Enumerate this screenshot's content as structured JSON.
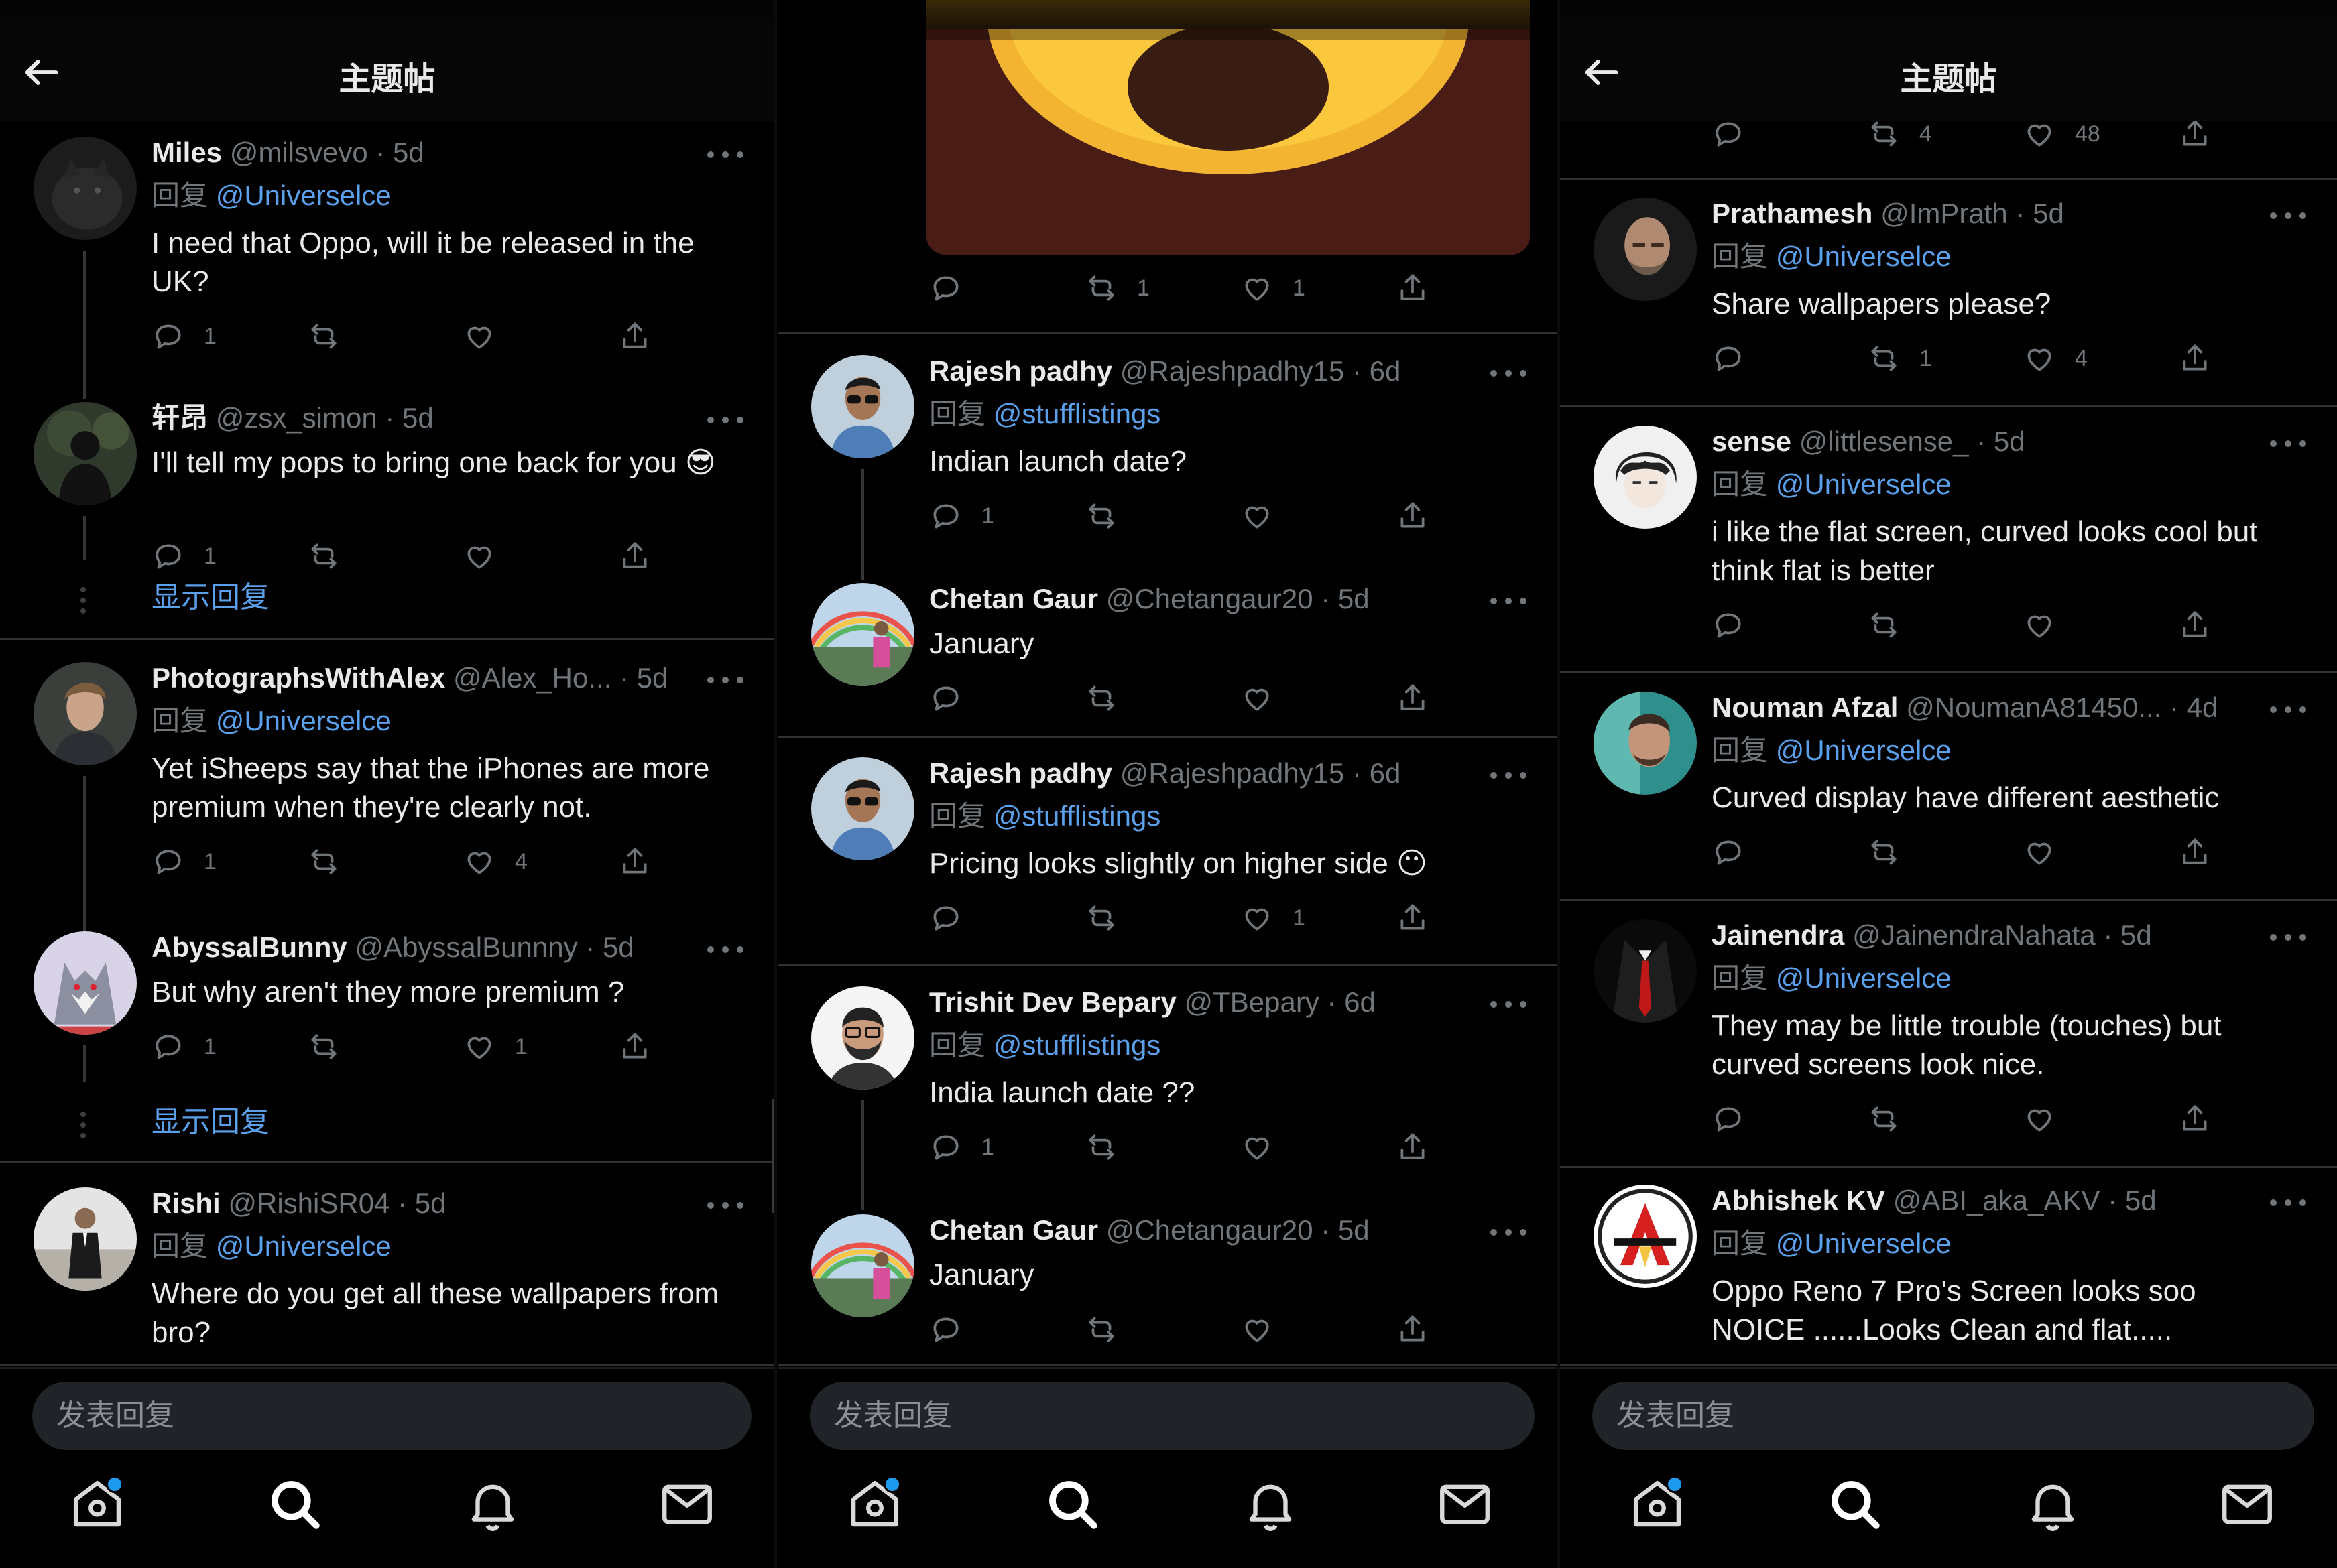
{
  "header": {
    "title": "主题帖"
  },
  "composer": {
    "placeholder": "发表回复"
  },
  "reply_prefix": "回复",
  "show_replies_label": "显示回复",
  "colors": {
    "mention": "#5aa0ea",
    "badge": "#1d9bf0",
    "background": "#000000"
  },
  "nav": [
    "home-icon",
    "search-icon",
    "bell-icon",
    "mail-icon"
  ],
  "panels": [
    {
      "tweets": [
        {
          "name": "Miles",
          "handle": "@milsvevo",
          "time": "· 5d",
          "reply_to": "@Universelce",
          "text": "I need that Oppo, will it be released in the UK?",
          "replies": "1",
          "retweets": "",
          "likes": ""
        },
        {
          "name": "轩昂",
          "handle": "@zsx_simon",
          "time": "· 5d",
          "reply_to": "",
          "text": "I'll tell my pops to bring one back for you 😎",
          "replies": "1",
          "retweets": "",
          "likes": ""
        },
        {
          "name": "PhotographsWithAlex",
          "handle": "@Alex_Ho...",
          "time": "· 5d",
          "reply_to": "@Universelce",
          "text": "Yet iSheeps say that the iPhones are more premium when they're clearly not.",
          "replies": "1",
          "retweets": "",
          "likes": "4"
        },
        {
          "name": "AbyssalBunny",
          "handle": "@AbyssalBunnny",
          "time": "· 5d",
          "reply_to": "",
          "text": "But why aren't they more premium ?",
          "replies": "1",
          "retweets": "",
          "likes": "1"
        },
        {
          "name": "Rishi",
          "handle": "@RishiSR04",
          "time": "· 5d",
          "reply_to": "@Universelce",
          "text": "Where do you get all these wallpapers from bro?",
          "replies": "",
          "retweets": "",
          "likes": ""
        }
      ]
    },
    {
      "image_actions": {
        "replies": "",
        "retweets": "1",
        "likes": "1"
      },
      "tweets": [
        {
          "name": "Rajesh padhy",
          "handle": "@Rajeshpadhy15",
          "time": "· 6d",
          "reply_to": "@stufflistings",
          "text": "Indian launch date?",
          "replies": "1",
          "retweets": "",
          "likes": ""
        },
        {
          "name": "Chetan Gaur",
          "handle": "@Chetangaur20",
          "time": "· 5d",
          "reply_to": "",
          "text": "January",
          "replies": "",
          "retweets": "",
          "likes": ""
        },
        {
          "name": "Rajesh padhy",
          "handle": "@Rajeshpadhy15",
          "time": "· 6d",
          "reply_to": "@stufflistings",
          "text": "Pricing looks slightly on higher side 😶",
          "replies": "",
          "retweets": "",
          "likes": "1"
        },
        {
          "name": "Trishit Dev Bepary",
          "handle": "@TBepary",
          "time": "· 6d",
          "reply_to": "@stufflistings",
          "text": "India launch date ??",
          "replies": "1",
          "retweets": "",
          "likes": ""
        },
        {
          "name": "Chetan Gaur",
          "handle": "@Chetangaur20",
          "time": "· 5d",
          "reply_to": "",
          "text": "January",
          "replies": "",
          "retweets": "",
          "likes": ""
        }
      ]
    },
    {
      "top_actions": {
        "replies": "",
        "retweets": "4",
        "likes": "48"
      },
      "tweets": [
        {
          "name": "Prathamesh",
          "handle": "@ImPrath",
          "time": "· 5d",
          "reply_to": "@Universelce",
          "text": "Share wallpapers please?",
          "replies": "",
          "retweets": "1",
          "likes": "4"
        },
        {
          "name": "sense",
          "handle": "@littlesense_",
          "time": "· 5d",
          "reply_to": "@Universelce",
          "text": "i like the flat screen, curved looks cool but think flat is better",
          "replies": "",
          "retweets": "",
          "likes": ""
        },
        {
          "name": "Nouman Afzal",
          "handle": "@NoumanA81450...",
          "time": "· 4d",
          "reply_to": "@Universelce",
          "text": "Curved display have different aesthetic",
          "replies": "",
          "retweets": "",
          "likes": ""
        },
        {
          "name": "Jainendra",
          "handle": "@JainendraNahata",
          "time": "· 5d",
          "reply_to": "@Universelce",
          "text": "They may be little trouble (touches) but curved screens look nice.",
          "replies": "",
          "retweets": "",
          "likes": ""
        },
        {
          "name": "Abhishek KV",
          "handle": "@ABI_aka_AKV",
          "time": "· 5d",
          "reply_to": "@Universelce",
          "text": "Oppo Reno 7 Pro's Screen looks soo NOICE ......Looks Clean and flat.....",
          "replies": "",
          "retweets": "",
          "likes": ""
        }
      ]
    }
  ]
}
